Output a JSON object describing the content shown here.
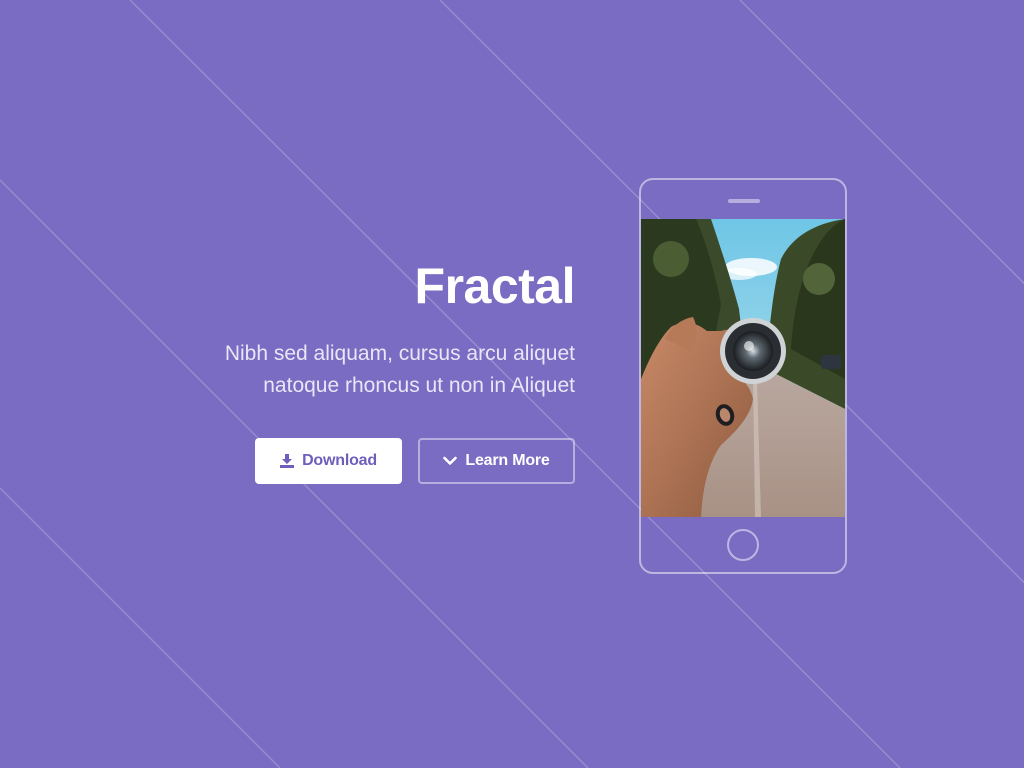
{
  "hero": {
    "title": "Fractal",
    "subtitle_line1": "Nibh sed aliquam, cursus arcu aliquet",
    "subtitle_line2": "natoque rhoncus ut non in Aliquet"
  },
  "buttons": {
    "download_label": "Download",
    "learn_more_label": "Learn More"
  },
  "icons": {
    "download": "download-icon",
    "learn_more": "chevron-down-icon"
  },
  "colors": {
    "background": "#7a6cc3",
    "accent": "#6e5fbd",
    "white": "#ffffff"
  }
}
